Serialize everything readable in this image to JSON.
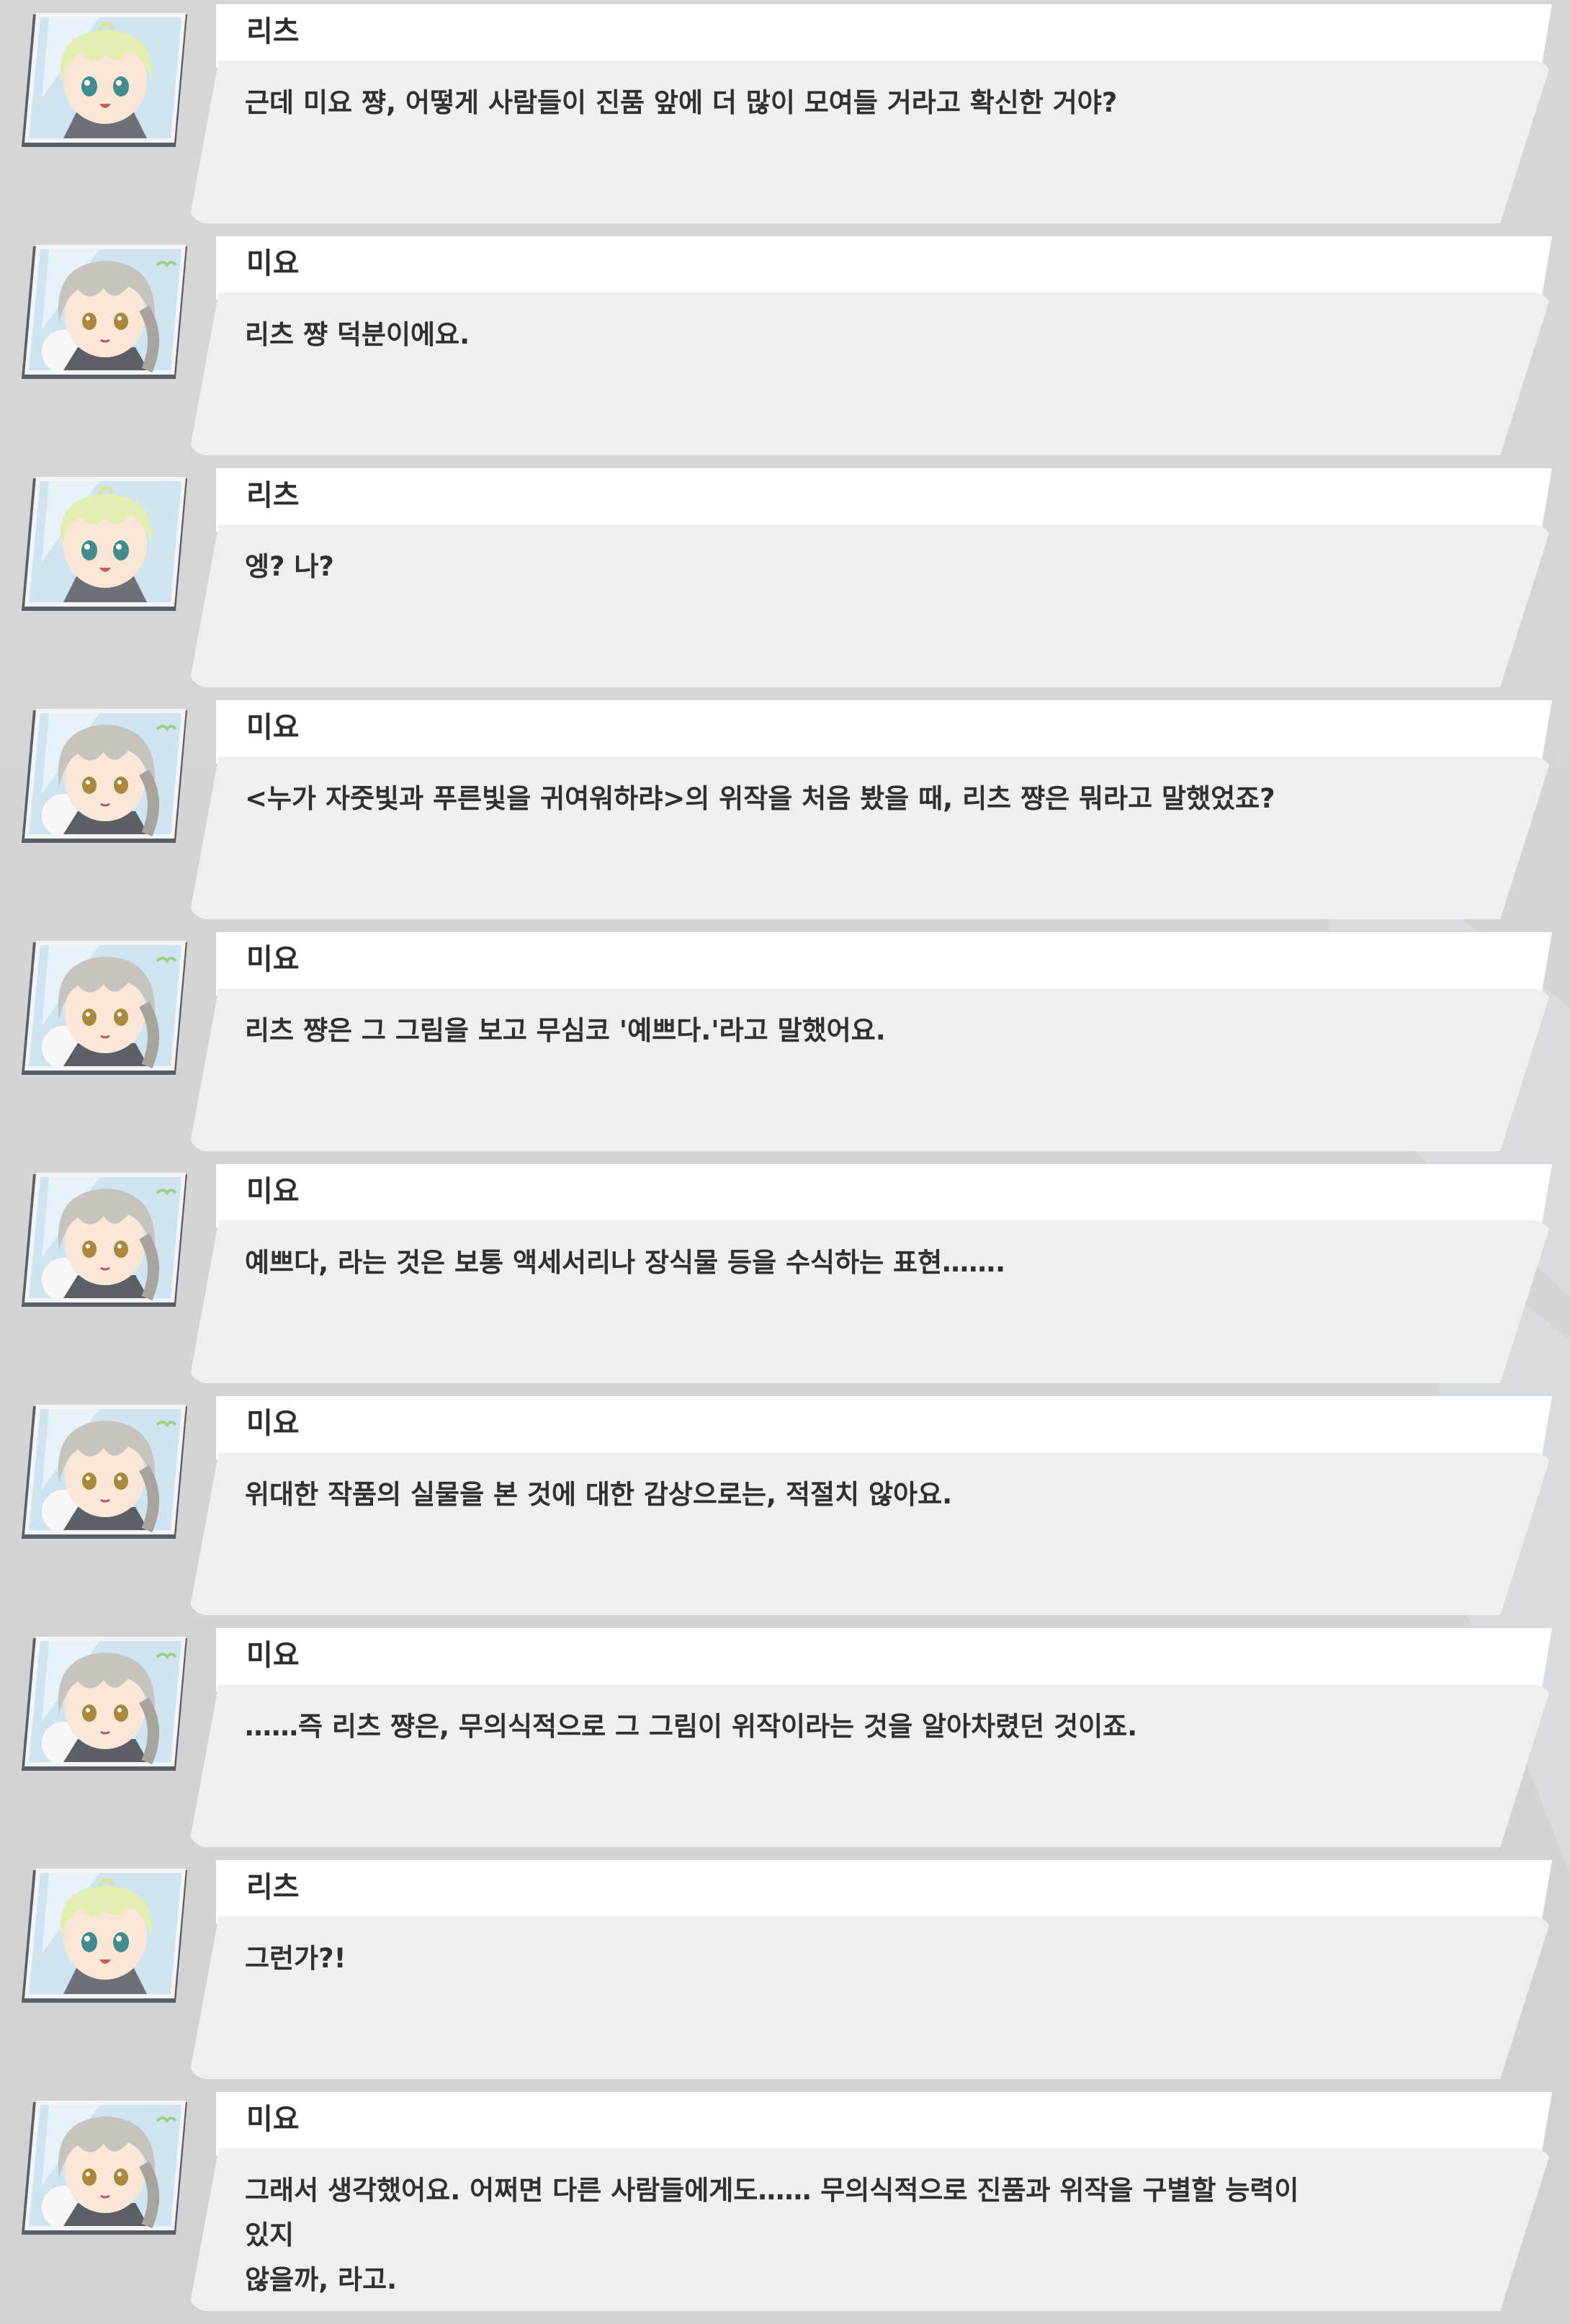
{
  "dialogue": [
    {
      "speaker": "리츠",
      "portrait": "ritsu-portrait",
      "text": "근데 미요 쨩, 어떻게 사람들이 진품 앞에 더 많이 모여들 거라고 확신한 거야?"
    },
    {
      "speaker": "미요",
      "portrait": "miyo-portrait",
      "text": "리츠 쨩 덕분이에요."
    },
    {
      "speaker": "리츠",
      "portrait": "ritsu-portrait",
      "text": "엥? 나?"
    },
    {
      "speaker": "미요",
      "portrait": "miyo-portrait",
      "text": "<누가 자줏빛과 푸른빛을 귀여워하랴>의 위작을 처음 봤을 때, 리츠 쨩은 뭐라고 말했었죠?"
    },
    {
      "speaker": "미요",
      "portrait": "miyo-portrait",
      "text": "리츠 쨩은 그 그림을 보고 무심코 '예쁘다.'라고 말했어요."
    },
    {
      "speaker": "미요",
      "portrait": "miyo-portrait",
      "text": "예쁘다, 라는 것은 보통 액세서리나 장식물 등을 수식하는 표현……."
    },
    {
      "speaker": "미요",
      "portrait": "miyo-portrait",
      "text": "위대한 작품의 실물을 본 것에 대한 감상으로는, 적절치 않아요."
    },
    {
      "speaker": "미요",
      "portrait": "miyo-portrait",
      "text": "……즉 리츠 쨩은, 무의식적으로 그 그림이 위작이라는 것을 알아차렸던 것이죠."
    },
    {
      "speaker": "리츠",
      "portrait": "ritsu-portrait",
      "text": "그런가?!"
    },
    {
      "speaker": "미요",
      "portrait": "miyo-portrait",
      "text": "그래서 생각했어요. 어쩌면 다른 사람들에게도…… 무의식적으로 진품과 위작을 구별할 능력이 있지\n않을까, 라고."
    }
  ],
  "colors": {
    "background": "#d4d4d4",
    "nameplate": "#ffffff",
    "bubble": "#efefef",
    "text": "#303030",
    "ritsu_hair": "#e4eeb0",
    "miyo_hair": "#c7c3be"
  }
}
